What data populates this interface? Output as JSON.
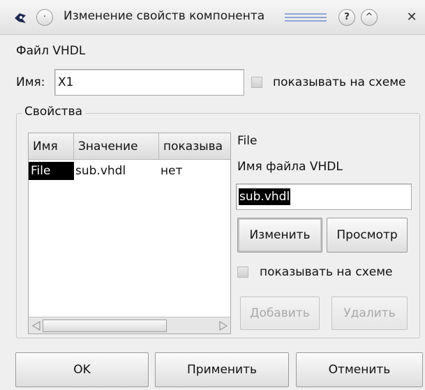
{
  "window": {
    "title": "Изменение свойств компонента",
    "help_symbol": "?",
    "shade_symbol": "^",
    "menu_symbol": "·",
    "close_symbol": "✕"
  },
  "header": {
    "file_type_label": "Файл VHDL"
  },
  "name_row": {
    "label": "Имя:",
    "value": "X1",
    "show_on_schematic_label": "показывать на схеме",
    "show_on_schematic_checked": false
  },
  "properties": {
    "group_title": "Свойства",
    "columns": [
      "Имя",
      "Значение",
      "показыва"
    ],
    "rows": [
      {
        "name": "File",
        "value": "sub.vhdl",
        "show": "нет"
      }
    ],
    "selected_name": "File",
    "description": "Имя файла VHDL",
    "edit_value": "sub.vhdl",
    "edit_button": "Изменить",
    "view_button": "Просмотр",
    "show_on_schematic_label": "показывать на схеме",
    "show_on_schematic_checked": false,
    "add_button": "Добавить",
    "remove_button": "Удалить"
  },
  "footer": {
    "ok": "OK",
    "apply": "Применить",
    "cancel": "Отменить"
  },
  "colors": {
    "selection": "#000000",
    "title_bar_lines": "#8fa6d6"
  }
}
